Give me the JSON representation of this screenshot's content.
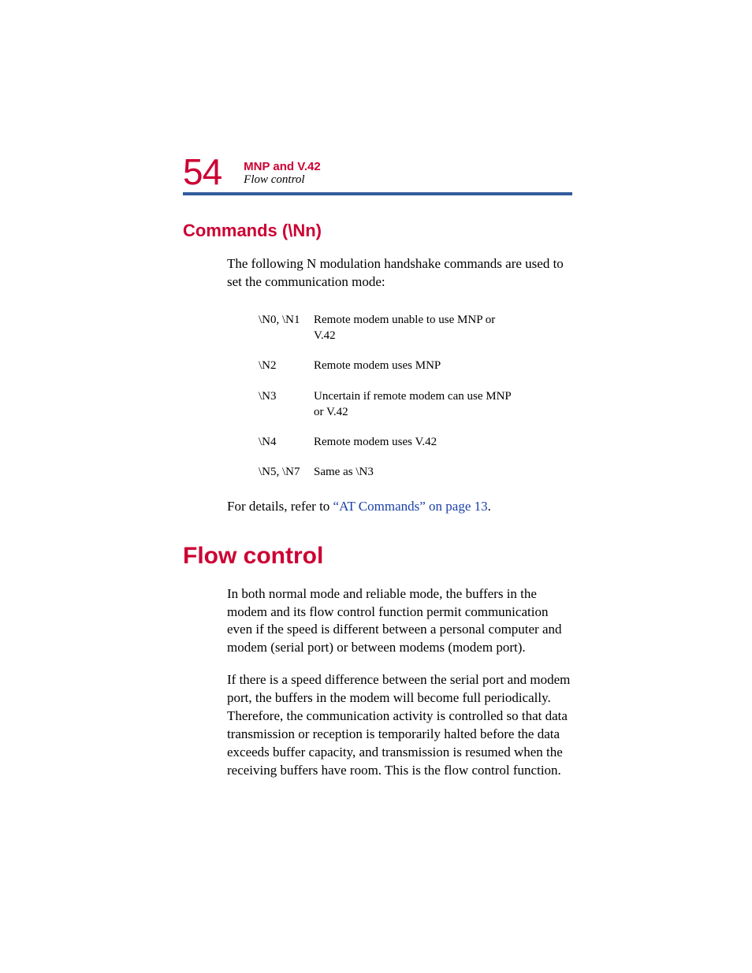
{
  "header": {
    "page_number": "54",
    "chapter": "MNP and V.42",
    "section": "Flow control"
  },
  "accent_color": "#cc0033",
  "rule_color": "#315b9c",
  "link_color": "#1a3fa8",
  "section1": {
    "heading": "Commands (\\Nn)",
    "intro": "The following N modulation handshake commands are used to set the communication mode:",
    "rows": [
      {
        "key": "\\N0, \\N1",
        "desc": "Remote modem unable to use MNP or V.42"
      },
      {
        "key": "\\N2",
        "desc": "Remote modem uses MNP"
      },
      {
        "key": "\\N3",
        "desc": "Uncertain if remote modem can use MNP or V.42"
      },
      {
        "key": "\\N4",
        "desc": "Remote modem uses V.42"
      },
      {
        "key": "\\N5, \\N7",
        "desc": "Same as \\N3"
      }
    ],
    "xref_prefix": "For details, refer to ",
    "xref_link": "“AT Commands” on page 13",
    "xref_suffix": "."
  },
  "section2": {
    "heading": "Flow control",
    "para1": "In both normal mode and reliable mode, the buffers in the modem and its flow control function permit communication even if the speed is different between a personal computer and modem (serial port) or between modems (modem port).",
    "para2": "If there is a speed difference between the serial port and modem port, the buffers in the modem will become full periodically. Therefore, the communication activity is controlled so that data transmission or reception is temporarily halted before the data exceeds buffer capacity, and transmission is resumed when the receiving buffers have room. This is the flow control function."
  }
}
